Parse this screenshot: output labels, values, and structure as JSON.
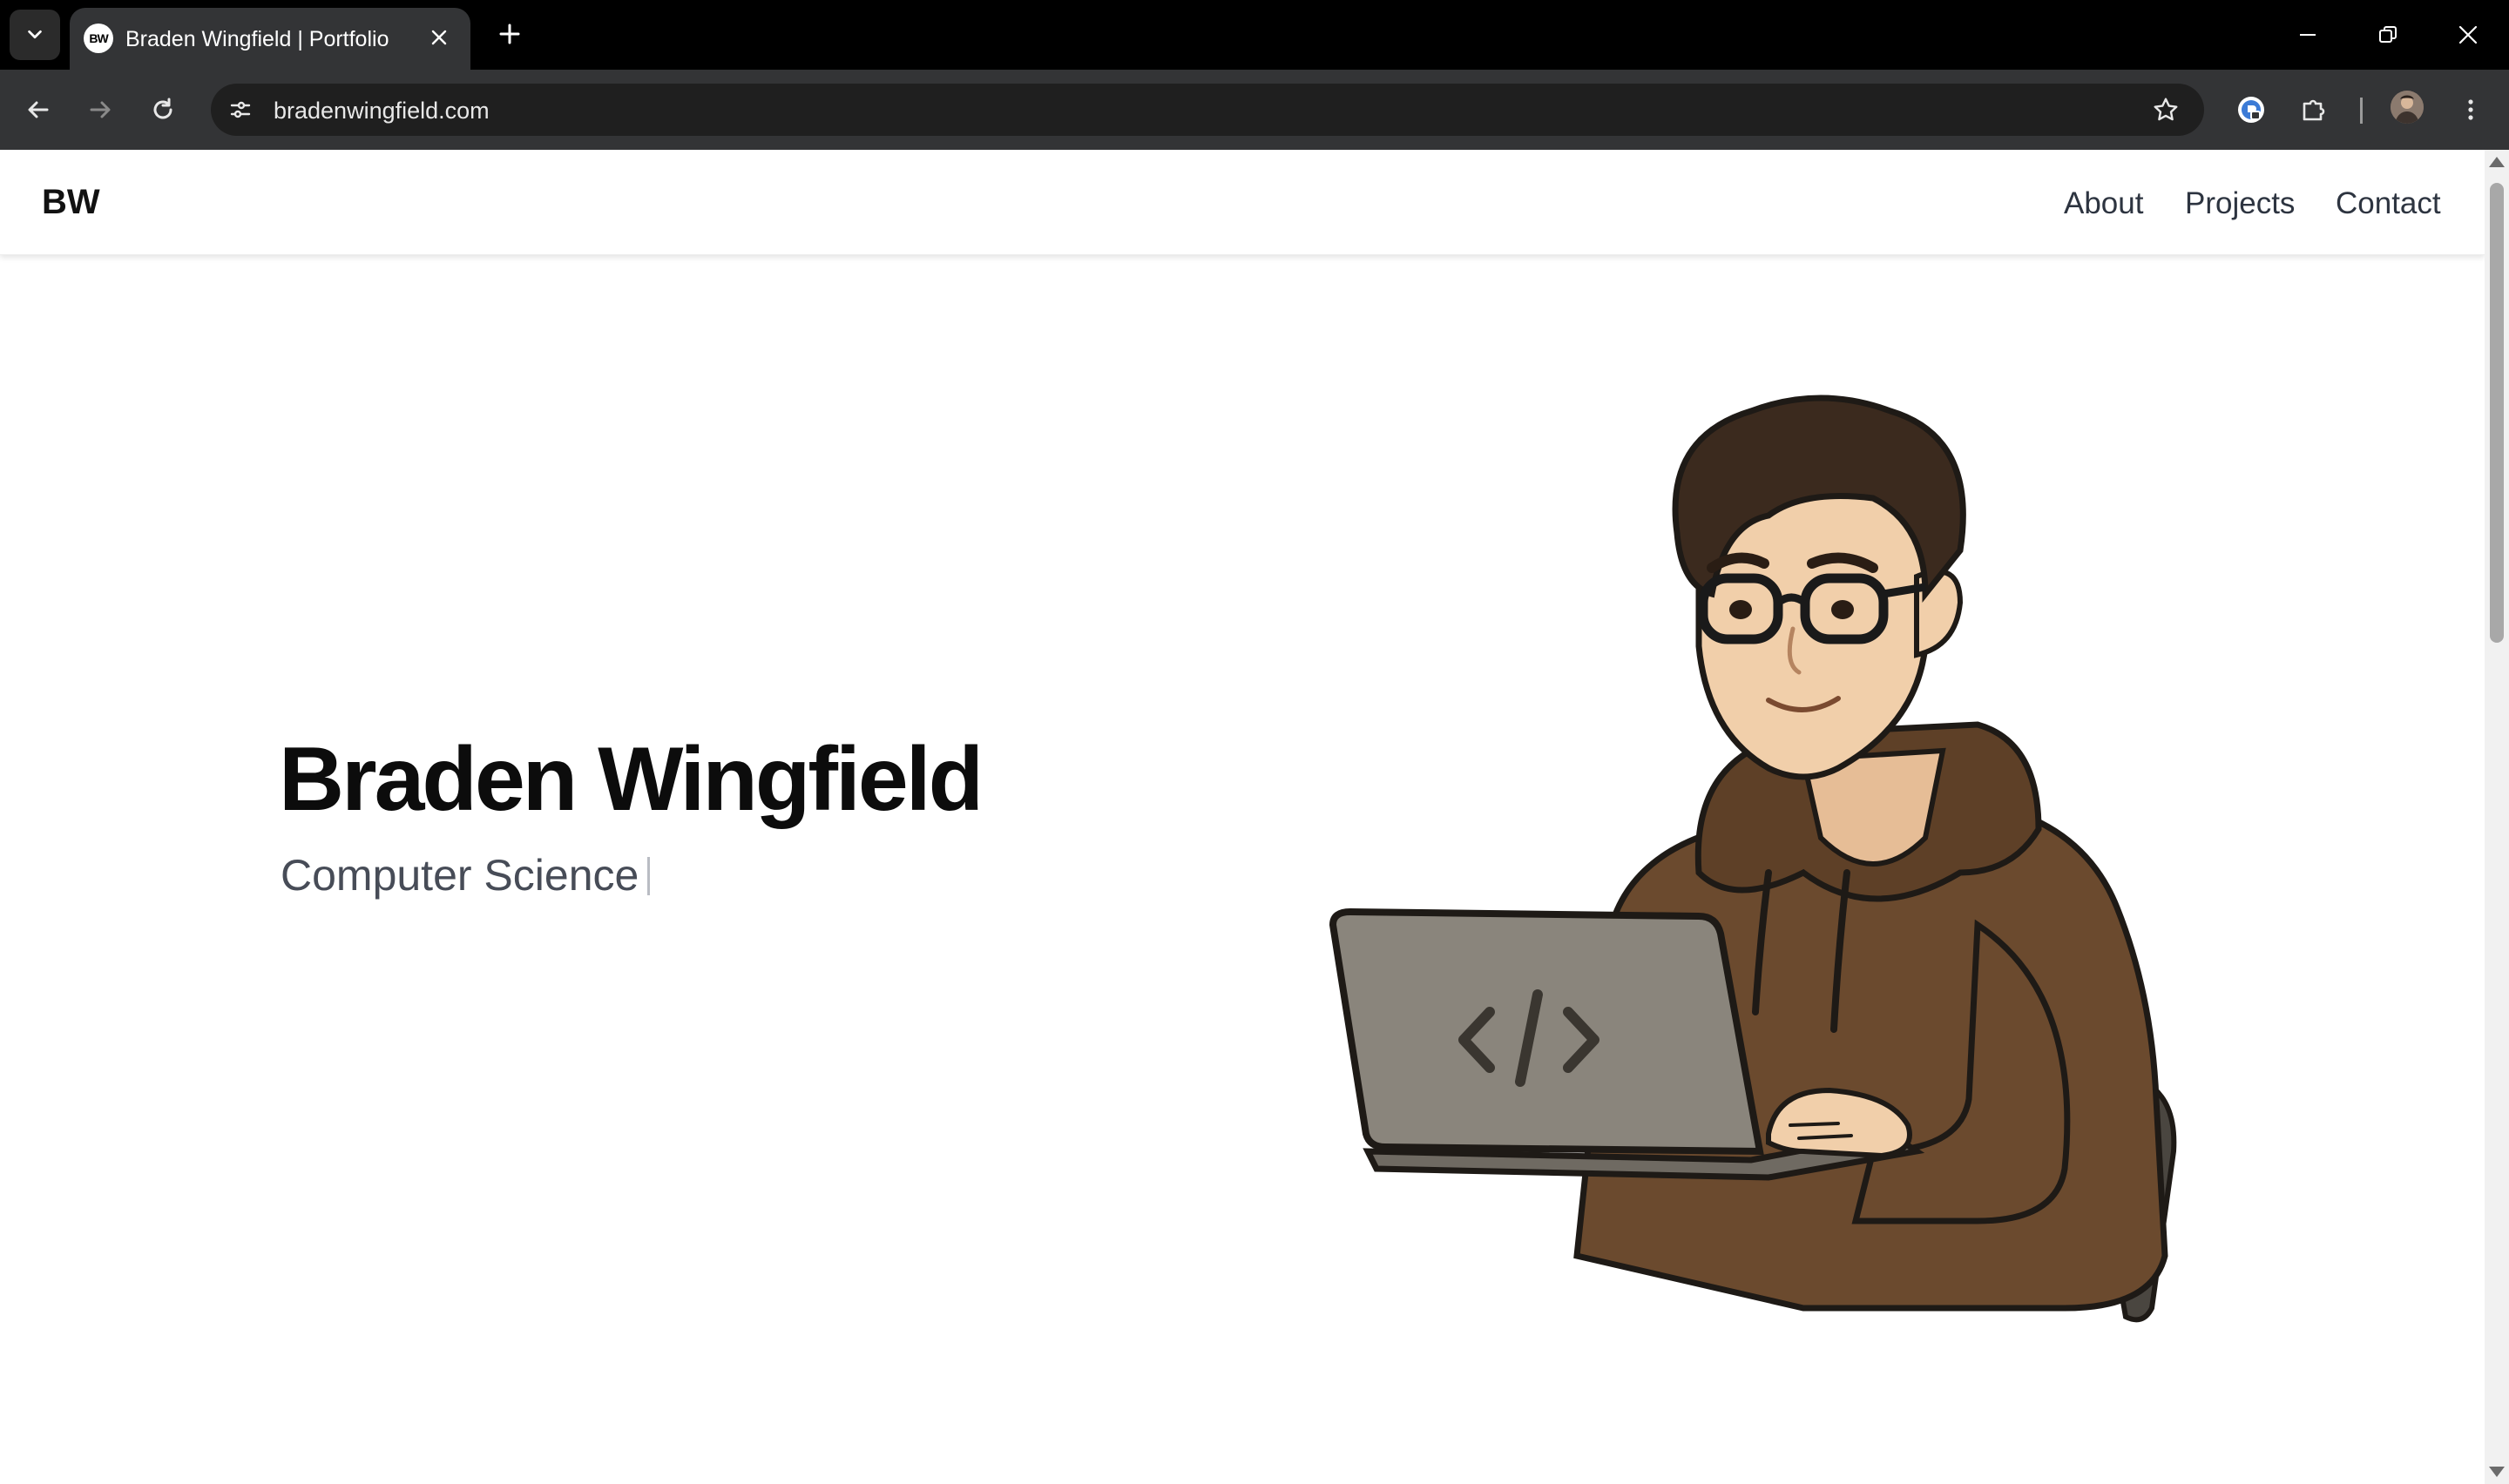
{
  "browser": {
    "tab": {
      "favicon_text": "BW",
      "title": "Braden Wingfield | Portfolio"
    },
    "url": "bradenwingfield.com",
    "icons": {
      "tab_search": "chevron-down-icon",
      "close_tab": "close-icon",
      "new_tab": "plus-icon",
      "back": "arrow-left-icon",
      "forward": "arrow-right-icon",
      "reload": "reload-icon",
      "site_info": "tune-icon",
      "bookmark": "star-icon",
      "extension_1": "password-manager-icon",
      "extensions": "puzzle-icon",
      "menu": "kebab-menu-icon"
    }
  },
  "site": {
    "logo": "BW",
    "nav": [
      "About",
      "Projects",
      "Contact"
    ],
    "hero": {
      "name": "Braden Wingfield",
      "subtitle": "Computer Science"
    }
  },
  "colors": {
    "hoodie": "#6b4a2e",
    "laptop": "#8a857c",
    "skin": "#f1cfaa",
    "hair": "#3b2a1e"
  }
}
